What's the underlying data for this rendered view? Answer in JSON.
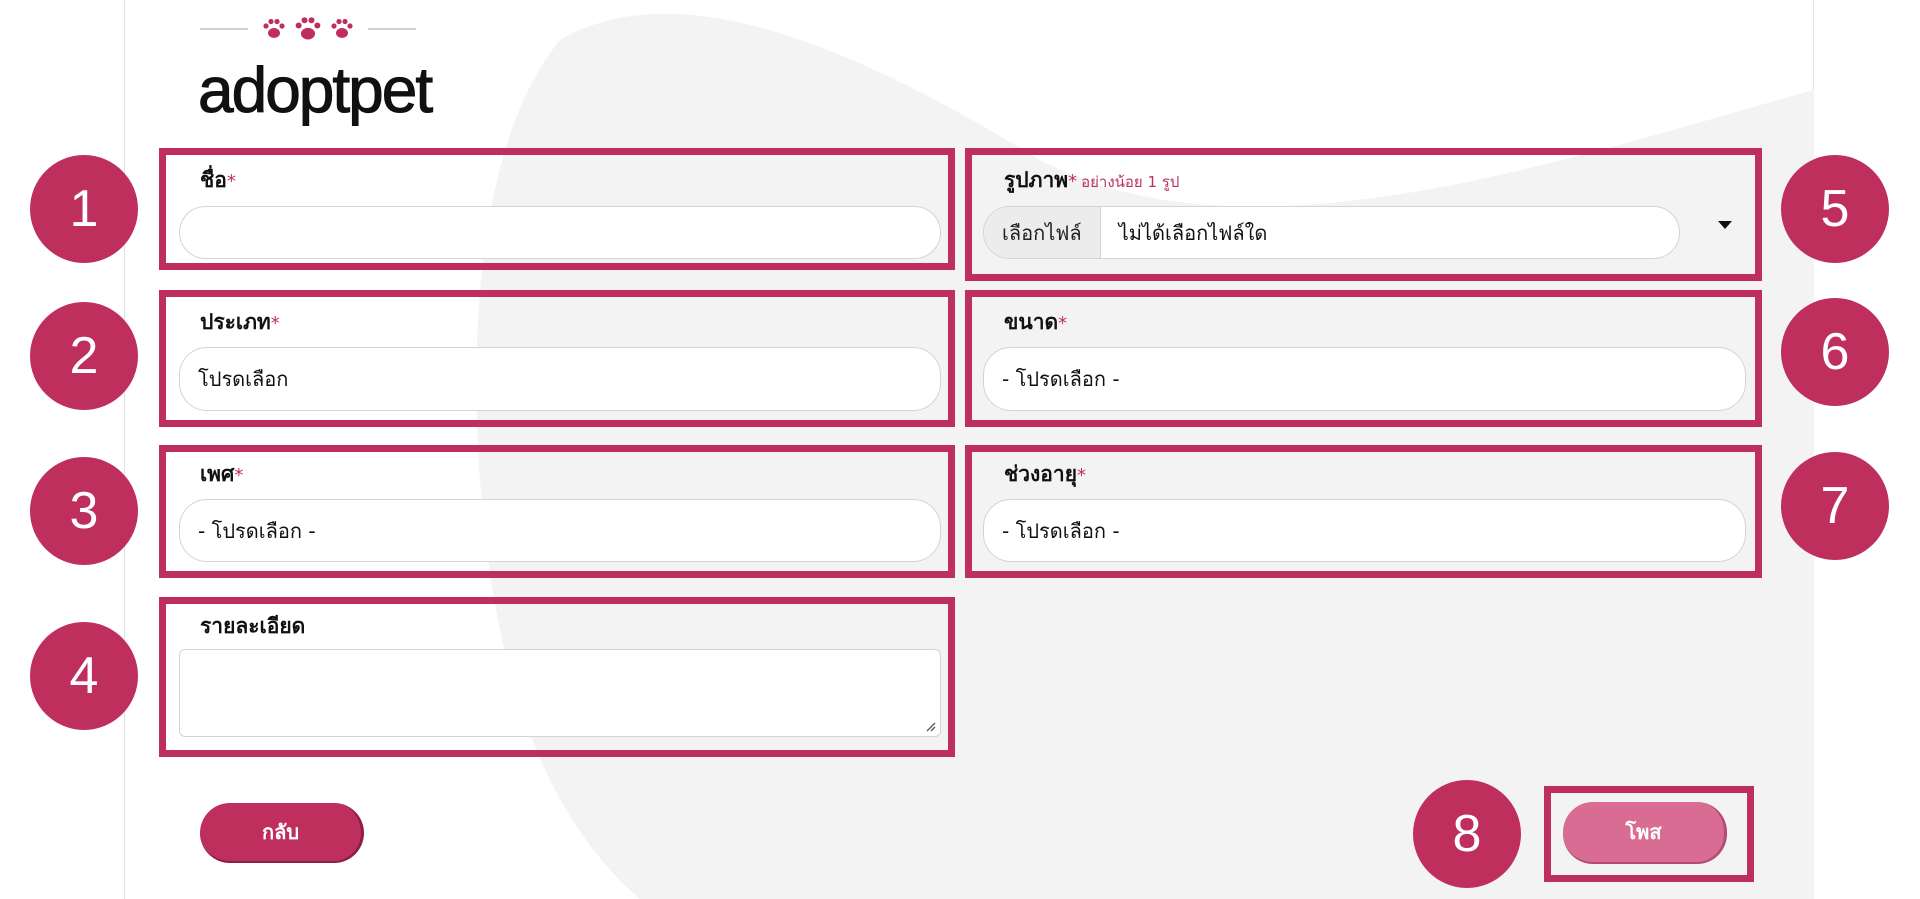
{
  "brand": {
    "logo_text": "adoptpet"
  },
  "form": {
    "name": {
      "label": "ชื่อ",
      "required": "*",
      "value": ""
    },
    "type": {
      "label": "ประเภท",
      "required": "*",
      "value": "โปรดเลือก"
    },
    "gender": {
      "label": "เพศ",
      "required": "*",
      "value": "- โปรดเลือก -"
    },
    "detail": {
      "label": "รายละเอียด",
      "value": ""
    },
    "image": {
      "label": "รูปภาพ",
      "required": "*",
      "hint": "อย่างน้อย 1 รูป",
      "button_label": "เลือกไฟล์",
      "status": "ไม่ได้เลือกไฟล์ใด"
    },
    "size": {
      "label": "ขนาด",
      "required": "*",
      "value": "- โปรดเลือก -"
    },
    "age_range": {
      "label": "ช่วงอายุ",
      "required": "*",
      "value": "- โปรดเลือก -"
    }
  },
  "buttons": {
    "back_label": "กลับ",
    "post_label": "โพส"
  },
  "callouts": [
    "1",
    "2",
    "3",
    "4",
    "5",
    "6",
    "7",
    "8"
  ],
  "colors": {
    "accent": "#bf2f5e",
    "post_button": "#d96c92",
    "field_border": "#d4d4d4"
  },
  "icons": {
    "paws": "paw-print-icon",
    "dropdown": "caret-down-icon",
    "resize": "resize-grip-icon"
  }
}
